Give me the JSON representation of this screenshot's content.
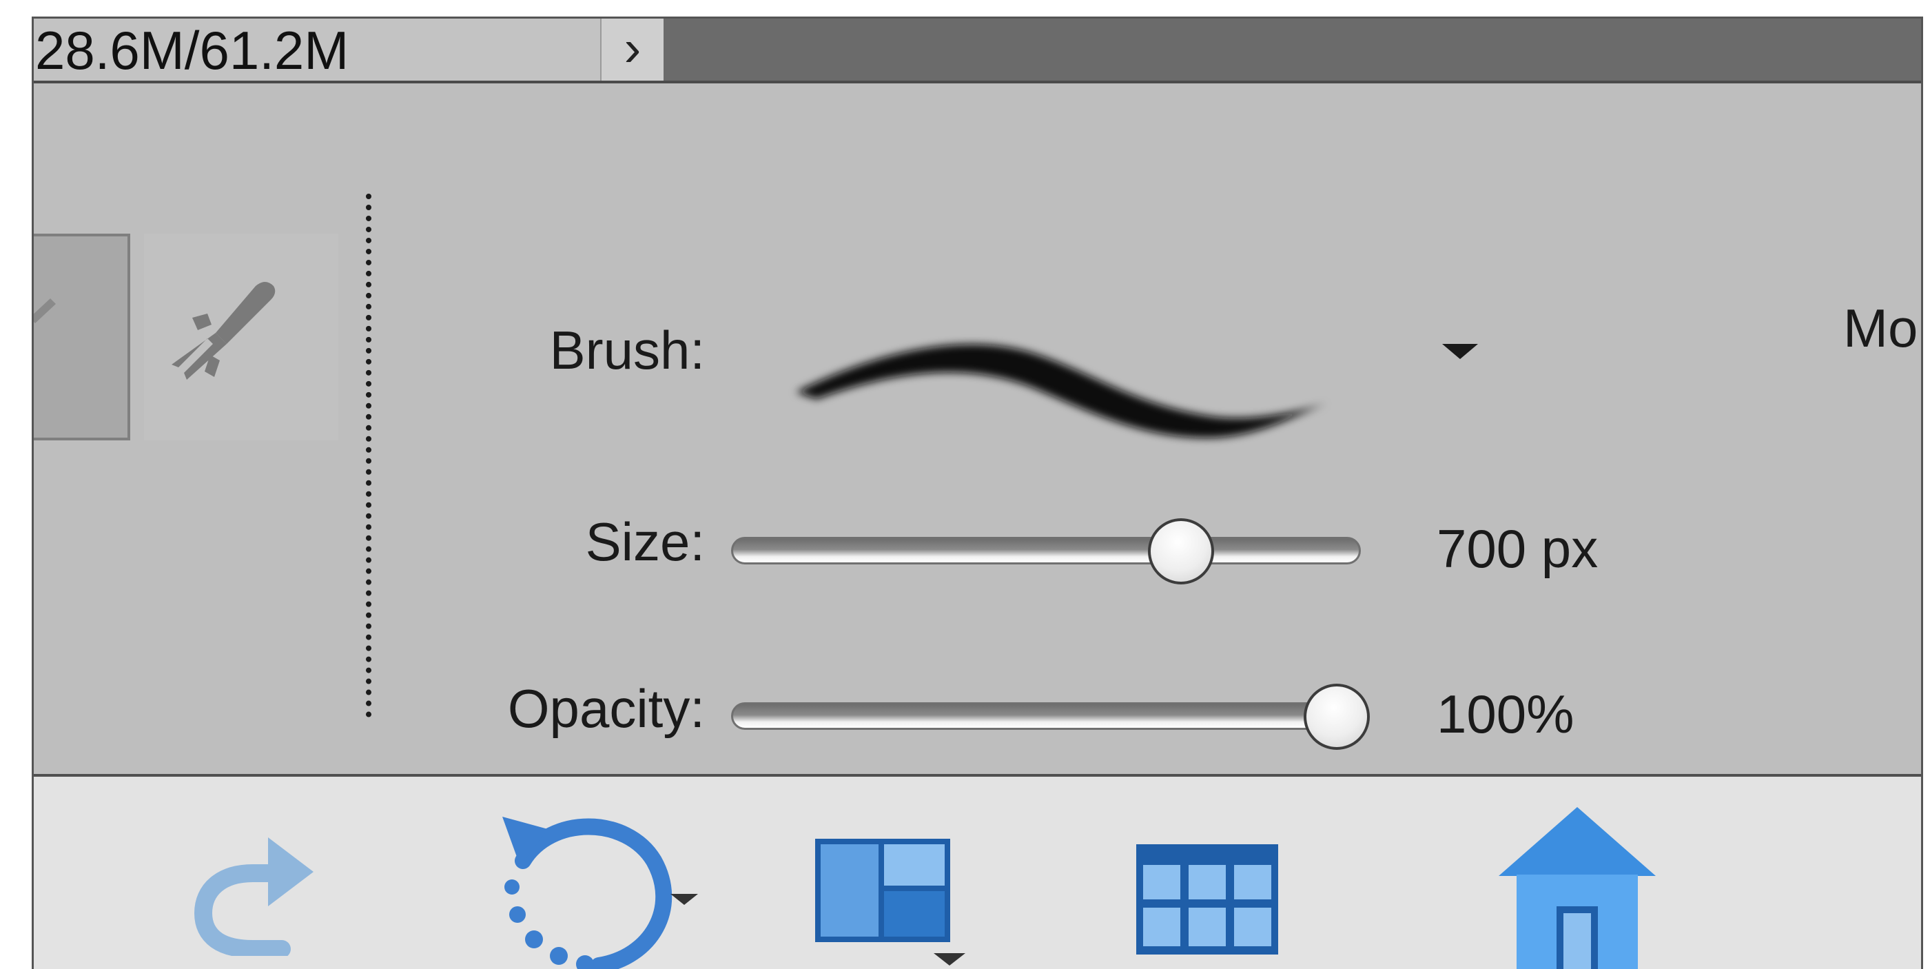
{
  "status_bar": {
    "memory_text": "28.6M/61.2M",
    "arrow_glyph": "›"
  },
  "options": {
    "brush": {
      "label": "Brush:"
    },
    "size": {
      "label": "Size:",
      "value_text": "700 px",
      "level": 0.73
    },
    "opacity": {
      "label": "Opacity:",
      "value_text": "100%",
      "level": 1.0
    },
    "mode": {
      "label": "Mo"
    }
  },
  "toolbar": {
    "items": [
      {
        "icon": "redo-icon"
      },
      {
        "icon": "rotate-icon"
      },
      {
        "icon": "layout-icon"
      },
      {
        "icon": "organizer-icon"
      },
      {
        "icon": "home-icon"
      }
    ]
  },
  "colors": {
    "panel": "#bebebe",
    "status_bar": "#6b6b6b",
    "toolbar": "#e3e3e3",
    "accent_blue": "#3c7fd0"
  }
}
